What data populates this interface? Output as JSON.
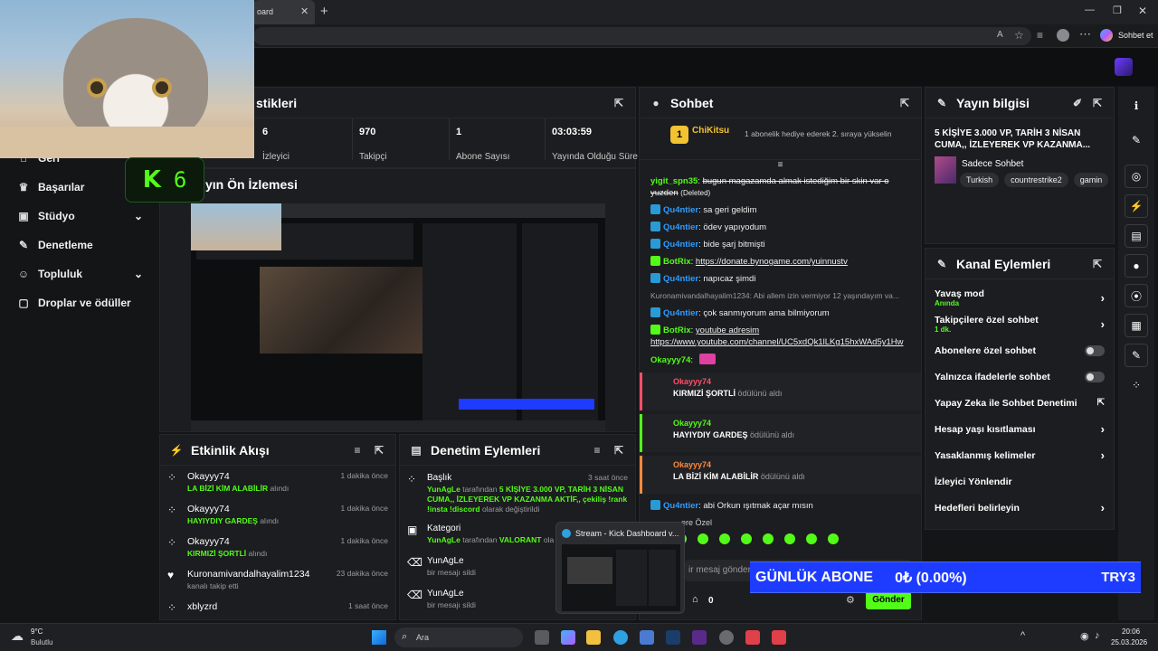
{
  "browser": {
    "tab_title": "oard",
    "copilot_label": "Sohbet et",
    "address": ""
  },
  "sidebar": {
    "items": [
      {
        "label": "Geri",
        "icon": "home-icon",
        "chevron": false
      },
      {
        "label": "Başarılar",
        "icon": "trophy-icon",
        "chevron": false
      },
      {
        "label": "Stüdyo",
        "icon": "studio-icon",
        "chevron": true
      },
      {
        "label": "Denetleme",
        "icon": "wrench-icon",
        "chevron": false
      },
      {
        "label": "Topluluk",
        "icon": "people-icon",
        "chevron": true
      },
      {
        "label": "Droplar ve ödüller",
        "icon": "gift-icon",
        "chevron": false
      }
    ]
  },
  "overlay": {
    "k_logo": "K",
    "k_number": "6"
  },
  "stats": {
    "title": "stikleri",
    "items": [
      {
        "value": "6",
        "label": "İzleyici"
      },
      {
        "value": "970",
        "label": "Takipçi"
      },
      {
        "value": "1",
        "label": "Abone Sayısı"
      },
      {
        "value": "03:03:59",
        "label": "Yayında Olduğu Süre"
      }
    ]
  },
  "preview": {
    "title": "yın Ön İzlemesi"
  },
  "activity": {
    "title": "Etkinlik Akışı",
    "rows": [
      {
        "user": "Okayyy74",
        "item": "LA BİZİ KİM ALABİLİR",
        "suffix": "alındı",
        "time": "1 dakika önce"
      },
      {
        "user": "Okayyy74",
        "item": "HAYIYDIY GARDEŞ",
        "suffix": "alındı",
        "time": "1 dakika önce"
      },
      {
        "user": "Okayyy74",
        "item": "KIRMIZİ ŞORTLİ",
        "suffix": "alındı",
        "time": "1 dakika önce"
      },
      {
        "user": "Kuronamivandalhayalim1234",
        "item": "",
        "suffix": "kanalı takip etti",
        "time": "23 dakika önce"
      },
      {
        "user": "xblyzrd",
        "item": "",
        "suffix": "",
        "time": "1 saat önce"
      }
    ]
  },
  "moderation": {
    "title": "Denetim Eylemleri",
    "rows": [
      {
        "head": "Başlık",
        "time": "3 saat önce",
        "by": "YunAgLe",
        "byText": "tarafından",
        "value": "5 KİŞİYE 3.000 VP, TARİH 3 NİSAN CUMA,, İZLEYEREK VP KAZANMA AKTİF,, çekiliş !rank !insta !discord",
        "tail": "olarak değiştirildi"
      },
      {
        "head": "Kategori",
        "time": "",
        "by": "YunAgLe",
        "byText": "tarafından",
        "value": "VALORANT",
        "tail": "ola"
      },
      {
        "head": "YunAgLe",
        "time": "",
        "by": "",
        "byText": "",
        "value": "",
        "tail": "bir mesajı sildi"
      },
      {
        "head": "YunAgLe",
        "time": "",
        "by": "",
        "byText": "",
        "value": "",
        "tail": "bir mesajı sildi"
      }
    ]
  },
  "chat": {
    "title": "Sohbet",
    "pinned_user": "ChiKitsu",
    "pinned_rank": "1",
    "pinned_text": "1 abonelik hediye ederek 2. sıraya yükselin",
    "lines": [
      {
        "user": "yigit_spn35",
        "color": "g",
        "text": "bugun magazamda almak istediğim bir skin var o yuzden",
        "note": "(Deleted)"
      },
      {
        "user": "Qu4ntier",
        "color": "b",
        "text": "sa geri geldim"
      },
      {
        "user": "Qu4ntier",
        "color": "b",
        "text": "ödev yapıyodum"
      },
      {
        "user": "Qu4ntier",
        "color": "b",
        "text": "bide şarj bitmişti"
      },
      {
        "user": "BotRix",
        "color": "g",
        "text": "https://donate.bynogame.com/yuinnustv"
      },
      {
        "user": "Qu4ntier",
        "color": "b",
        "text": "napıcaz şimdi"
      },
      {
        "user": "",
        "color": "m",
        "text": "Kuronamivandalhayalim1234: Abi allem izin vermiyor 12 yaşındayım va..."
      },
      {
        "user": "Qu4ntier",
        "color": "b",
        "text": "çok sanmıyorum ama bilmiyorum"
      },
      {
        "user": "BotRix",
        "color": "g",
        "text": "youtube adresim https://www.youtube.com/channel/UC5xdQk1lLKg15hxWAd5y1Hw"
      },
      {
        "user": "Okayyy74",
        "color": "g",
        "text": ""
      }
    ],
    "redeems": [
      {
        "user": "Okayyy74",
        "ucolor": "#ff4f6a",
        "bar": "#ff4f6a",
        "item": "KIRMIZİ ŞORTLİ",
        "suffix": "ödülünü aldı"
      },
      {
        "user": "Okayyy74",
        "ucolor": "#53fc18",
        "bar": "#53fc18",
        "item": "HAYIYDIY GARDEŞ",
        "suffix": "ödülünü aldı"
      },
      {
        "user": "Okayyy74",
        "ucolor": "#ff8a3d",
        "bar": "#ff8a3d",
        "item": "LA BİZİ KİM ALABİLİR",
        "suffix": "ödülünü aldı"
      }
    ],
    "last_line": {
      "user": "Qu4ntier",
      "text": "abi Orkun ışıtmak açar mısın"
    },
    "emote_label": "ere Özel",
    "input_placeholder": "ir mesaj gönder",
    "points": "0",
    "send_label": "Gönder"
  },
  "stream_info": {
    "title": "Yayın bilgisi",
    "stream_title": "5 KİŞİYE 3.000 VP, TARİH 3 NİSAN CUMA,, İZLEYEREK VP KAZANMA...",
    "category": "Sadece Sohbet",
    "tags": [
      "Turkish",
      "countrestrike2",
      "gamin"
    ]
  },
  "channel_actions": {
    "title": "Kanal Eylemleri",
    "rows": [
      {
        "label": "Yavaş mod",
        "sub": "Anında",
        "control": "chevron"
      },
      {
        "label": "Takipçilere özel sohbet",
        "sub": "1 dk.",
        "control": "chevron"
      },
      {
        "label": "Abonelere özel sohbet",
        "sub": "",
        "control": "toggle"
      },
      {
        "label": "Yalnızca ifadelerle sohbet",
        "sub": "",
        "control": "toggle"
      },
      {
        "label": "Yapay Zeka ile Sohbet Denetimi",
        "sub": "",
        "control": "external"
      },
      {
        "label": "Hesap yaşı kısıtlaması",
        "sub": "",
        "control": "chevron"
      },
      {
        "label": "Yasaklanmış kelimeler",
        "sub": "",
        "control": "chevron"
      },
      {
        "label": "İzleyici Yönlendir",
        "sub": "",
        "control": "none"
      },
      {
        "label": "Hedefleri belirleyin",
        "sub": "",
        "control": "chevron"
      }
    ]
  },
  "sub_banner": {
    "label": "GÜNLÜK ABONE",
    "value": "0₺ (0.00%)",
    "right": "TRY3"
  },
  "thumbnail_popup": {
    "title": "Stream - Kick Dashboard v..."
  },
  "taskbar": {
    "weather_temp": "9°C",
    "weather_desc": "Bulutlu",
    "search": "Ara",
    "time": "20:06",
    "date": "25.03.2026"
  },
  "colors": {
    "accent": "#53fc18",
    "panel": "#1c1d20",
    "banner": "#1e3cff"
  }
}
